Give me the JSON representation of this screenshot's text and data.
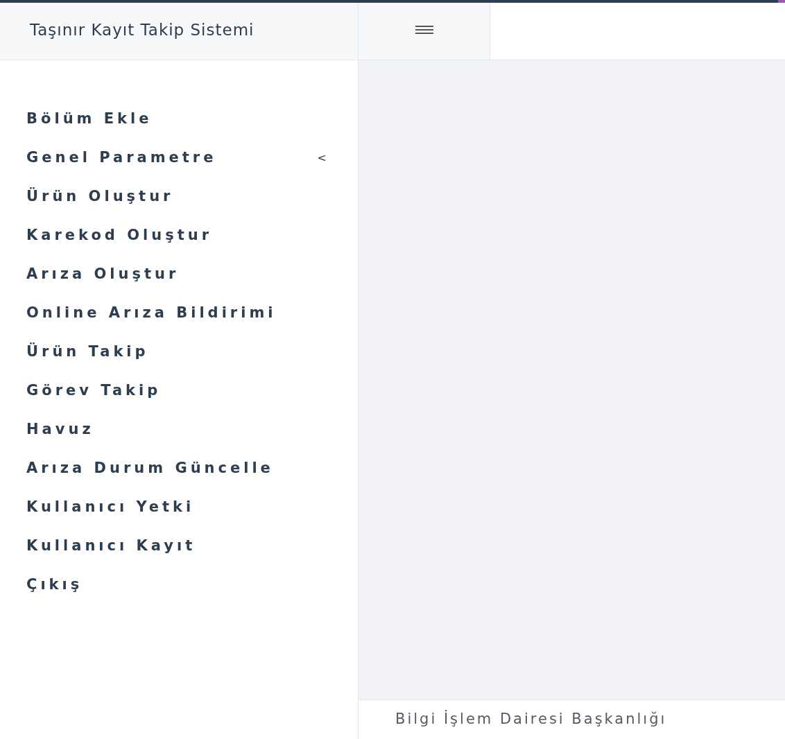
{
  "sidebar": {
    "title": "Taşınır Kayıt Takip Sistemi",
    "items": [
      {
        "label": "Bölüm Ekle"
      },
      {
        "label": "Genel Parametre",
        "caret": "<"
      },
      {
        "label": "Ürün Oluştur"
      },
      {
        "label": "Karekod Oluştur"
      },
      {
        "label": "Arıza Oluştur"
      },
      {
        "label": "Online Arıza Bildirimi"
      },
      {
        "label": "Ürün Takip"
      },
      {
        "label": "Görev Takip"
      },
      {
        "label": "Havuz"
      },
      {
        "label": "Arıza Durum Güncelle"
      },
      {
        "label": "Kullanıcı Yetki"
      },
      {
        "label": "Kullanıcı Kayıt"
      },
      {
        "label": "Çıkış"
      }
    ]
  },
  "footer": {
    "text": "Bilgi İşlem Dairesi Başkanlığı"
  }
}
